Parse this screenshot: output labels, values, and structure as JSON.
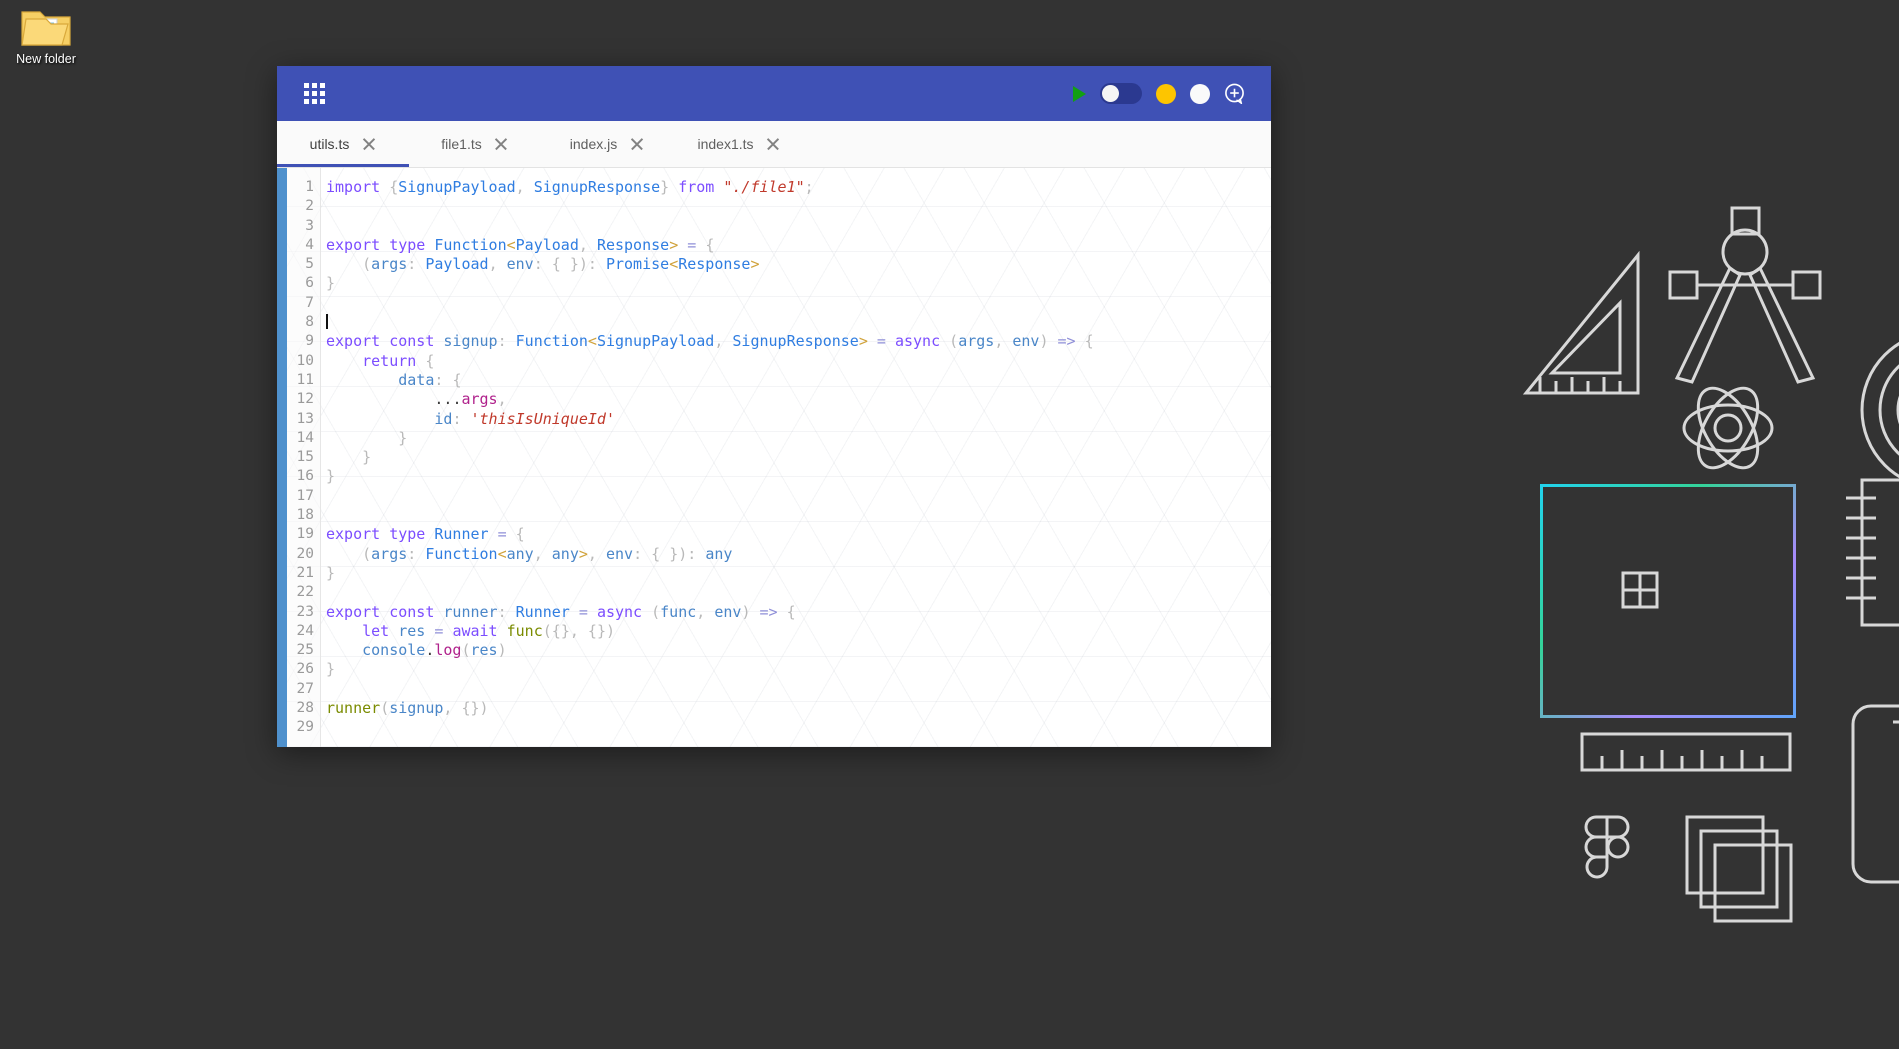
{
  "desktop": {
    "background_color": "#333333",
    "icon": {
      "name": "New folder",
      "type": "folder-icon"
    }
  },
  "window": {
    "titlebar": {
      "background_color": "#3f51b5",
      "app_menu_icon": "grid-icon",
      "controls": [
        {
          "name": "run-button",
          "icon": "play-triangle-icon",
          "color": "#12a012"
        },
        {
          "name": "theme-toggle",
          "icon": "toggle-switch-icon",
          "state": "off",
          "track_color": "#2b3990",
          "knob_color": "#f5f5f5"
        },
        {
          "name": "minimize-button",
          "icon": "circle-icon",
          "color": "#fdc500"
        },
        {
          "name": "maximize-button",
          "icon": "circle-icon",
          "color": "#fafafa"
        },
        {
          "name": "zoom-in-button",
          "icon": "circle-plus-icon",
          "color": "#ffffff"
        }
      ]
    },
    "tabs": [
      {
        "label": "utils.ts",
        "active": true,
        "close": "×"
      },
      {
        "label": "file1.ts",
        "active": false,
        "close": "×"
      },
      {
        "label": "index.js",
        "active": false,
        "close": "×"
      },
      {
        "label": "index1.ts",
        "active": false,
        "close": "×"
      }
    ],
    "active_tab_underline_color": "#3f51b5",
    "editor_accent_bar_color": "#4f91cd",
    "cursor_line": 8,
    "line_numbers": [
      1,
      2,
      3,
      4,
      5,
      6,
      7,
      8,
      9,
      10,
      11,
      12,
      13,
      14,
      15,
      16,
      17,
      18,
      19,
      20,
      21,
      22,
      23,
      24,
      25,
      26,
      27,
      28,
      29
    ],
    "code_lines": [
      "import {SignupPayload, SignupResponse} from \"./file1\";",
      "",
      "",
      "export type Function<Payload, Response> = {",
      "    (args: Payload, env: { }): Promise<Response>",
      "}",
      "",
      "",
      "export const signup: Function<SignupPayload, SignupResponse> = async (args, env) => {",
      "    return {",
      "        data: {",
      "            ...args,",
      "            id: 'thisIsUniqueId'",
      "        }",
      "    }",
      "}",
      "",
      "",
      "export type Runner = {",
      "    (args: Function<any, any>, env: { }): any",
      "}",
      "",
      "export const runner: Runner = async (func, env) => {",
      "    let res = await func({}, {})",
      "    console.log(res)",
      "}",
      "",
      "runner(signup, {})",
      ""
    ]
  }
}
